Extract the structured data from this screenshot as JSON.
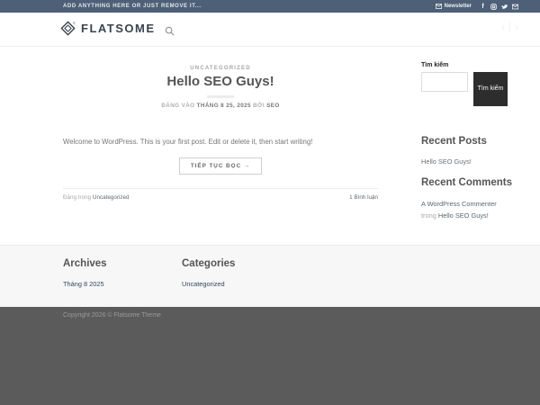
{
  "topbar": {
    "left_text": "ADD ANYTHING HERE OR JUST REMOVE IT...",
    "newsletter_label": "Newsletter",
    "social_icons": [
      "facebook",
      "instagram",
      "twitter",
      "email"
    ]
  },
  "header": {
    "logo_text": "FLATSOME",
    "pagination": {
      "prev": "‹",
      "next": "›"
    }
  },
  "post": {
    "category": "UNCATEGORIZED",
    "title": "Hello SEO Guys!",
    "meta_posted": "ĐĂNG VÀO",
    "meta_date": "THÁNG 8 25, 2025",
    "meta_by": "BỞI",
    "meta_author": "SEO",
    "excerpt": "Welcome to WordPress. This is your first post. Edit or delete it, then start writing!",
    "read_more_label": "TIẾP TỤC ĐỌC →",
    "posted_in_label": "Đăng trong",
    "posted_in_category": "Uncategorized",
    "comments_label": "1 Bình luận"
  },
  "sidebar": {
    "search_label": "Tìm kiếm",
    "search_button_label": "Tìm kiếm",
    "search_placeholder": "",
    "recent_posts_title": "Recent Posts",
    "recent_posts": [
      "Hello SEO Guys!"
    ],
    "recent_comments_title": "Recent Comments",
    "recent_comments": [
      {
        "author": "A WordPress Commenter",
        "connector": "trong",
        "post": "Hello SEO Guys!"
      }
    ]
  },
  "footer": {
    "archives_title": "Archives",
    "archives": [
      "Tháng 8 2025"
    ],
    "categories_title": "Categories",
    "categories": [
      "Uncategorized"
    ],
    "copyright": "Copyright 2026 © Flatsome Theme"
  },
  "colors": {
    "topbar_bg": "#4d6078",
    "logo_text": "#39444d",
    "heading": "#555555",
    "body_text": "#777777",
    "link": "#334862",
    "search_button_bg": "#2d2d2d",
    "footer_widgets_bg": "#f7f7f7",
    "footer_dark_bg": "#5b5b5b"
  }
}
